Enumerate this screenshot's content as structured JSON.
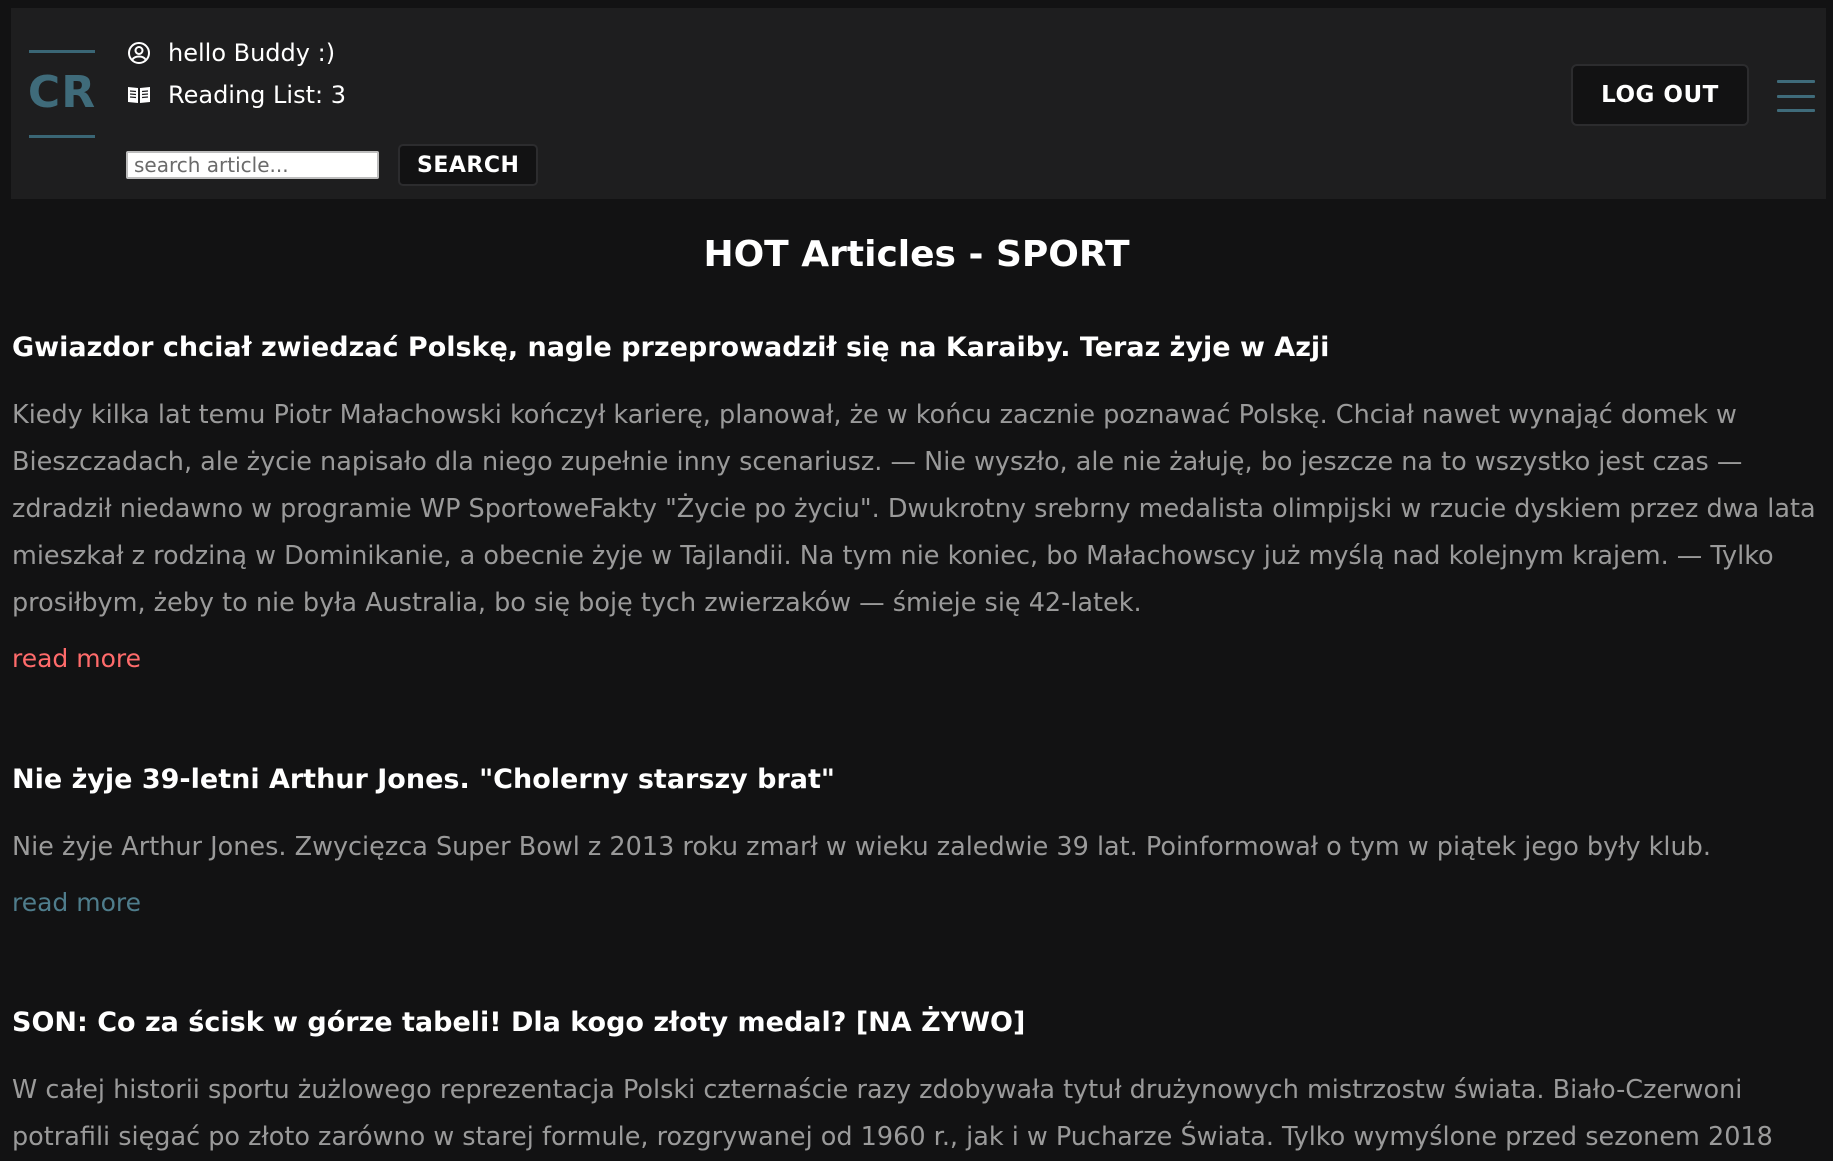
{
  "header": {
    "logo_text": "CR",
    "greeting": "hello Buddy :)",
    "reading_list": "Reading List: 3",
    "search": {
      "placeholder": "search article...",
      "value": ""
    },
    "search_button_label": "SEARCH",
    "logout_label": "LOG OUT",
    "icons": {
      "user": "user-circle-icon",
      "reading_list": "open-book-icon",
      "menu": "hamburger-menu-icon"
    }
  },
  "main": {
    "page_title": "HOT Articles - SPORT",
    "articles": [
      {
        "title": "Gwiazdor chciał zwiedzać Polskę, nagle przeprowadził się na Karaiby. Teraz żyje w Azji",
        "body": "Kiedy kilka lat temu Piotr Małachowski kończył karierę, planował, że w końcu zacznie poznawać Polskę. Chciał nawet wynająć domek w Bieszczadach, ale życie napisało dla niego zupełnie inny scenariusz. — Nie wyszło, ale nie żałuję, bo jeszcze na to wszystko jest czas — zdradził niedawno w programie WP SportoweFakty \"Życie po życiu\". Dwukrotny srebrny medalista olimpijski w rzucie dyskiem przez dwa lata mieszkał z rodziną w Dominikanie, a obecnie żyje w Tajlandii. Na tym nie koniec, bo Małachowscy już myślą nad kolejnym krajem. — Tylko prosiłbym, żeby to nie była Australia, bo się boję tych zwierzaków — śmieje się 42-latek.",
        "read_more": "read more",
        "read_more_color": "#ff6b6b"
      },
      {
        "title": "Nie żyje 39-letni Arthur Jones. \"Cholerny starszy brat\"",
        "body": "Nie żyje Arthur Jones. Zwycięzca Super Bowl z 2013 roku zmarł w wieku zaledwie 39 lat. Poinformował o tym w piątek jego były klub.",
        "read_more": "read more",
        "read_more_color": "#4f7d8c"
      },
      {
        "title": "SON: Co za ścisk w górze tabeli! Dla kogo złoty medal? [NA ŻYWO]",
        "body": "W całej historii sportu żużlowego reprezentacja Polski czternaście razy zdobywała tytuł drużynowych mistrzostw świata. Biało-Czerwoni potrafili sięgać po złoto zarówno w starej formule, rozgrywanej od 1960 r., jak i w Pucharze Świata. Tylko wymyślone przed sezonem 2018"
      }
    ]
  },
  "colors": {
    "background": "#121213",
    "header_background": "#1e1e1f",
    "accent": "#3f6b7a",
    "body_text": "#9a9a9a"
  }
}
